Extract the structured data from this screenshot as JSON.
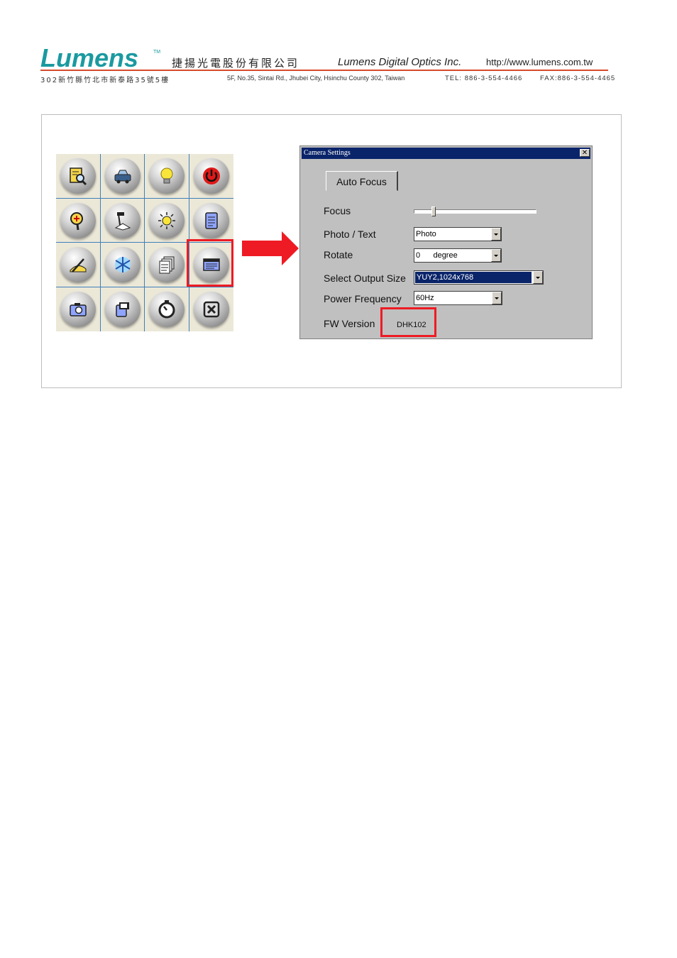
{
  "header": {
    "logo_text": "Lumens",
    "trademark": "TM",
    "company_name_cn": "捷揚光電股份有限公司",
    "company_name_en": "Lumens Digital Optics Inc.",
    "website": "http://www.lumens.com.tw",
    "address_cn": "302新竹縣竹北市新泰路35號5樓",
    "address_en": "5F, No.35, Sintai Rd., Jhubei City, Hsinchu County 302, Taiwan",
    "tel": "TEL: 886-3-554-4466",
    "fax": "FAX:886-3-554-4465",
    "rule_color": "#d64a2a",
    "logo_color": "#1a9aa0"
  },
  "toolbar_grid": {
    "icons": [
      "document-magnify-icon",
      "scanner-car-icon",
      "lightbulb-icon",
      "power-icon",
      "zoom-in-icon",
      "document-camera-icon",
      "brightness-icon",
      "clipboard-icon",
      "annotate-pen-icon",
      "freeze-snowflake-icon",
      "copy-pages-icon",
      "settings-panel-icon",
      "camera-capture-icon",
      "video-record-icon",
      "timer-icon",
      "close-x-icon"
    ],
    "highlighted_icon": "settings-panel-icon",
    "highlight_color": "#ee1b24"
  },
  "dialog": {
    "title": "Camera Settings",
    "close_glyph": "✕",
    "auto_focus_label": "Auto Focus",
    "focus_label": "Focus",
    "focus_level": 0.15,
    "photo_text_label": "Photo / Text",
    "photo_text_value": "Photo",
    "rotate_label": "Rotate",
    "rotate_value": "0      degree",
    "output_size_label": "Select Output Size",
    "output_size_value": "YUY2,1024x768",
    "power_freq_label": "Power Frequency",
    "power_freq_value": "60Hz",
    "fw_label": "FW Version",
    "fw_value": "DHK102"
  }
}
